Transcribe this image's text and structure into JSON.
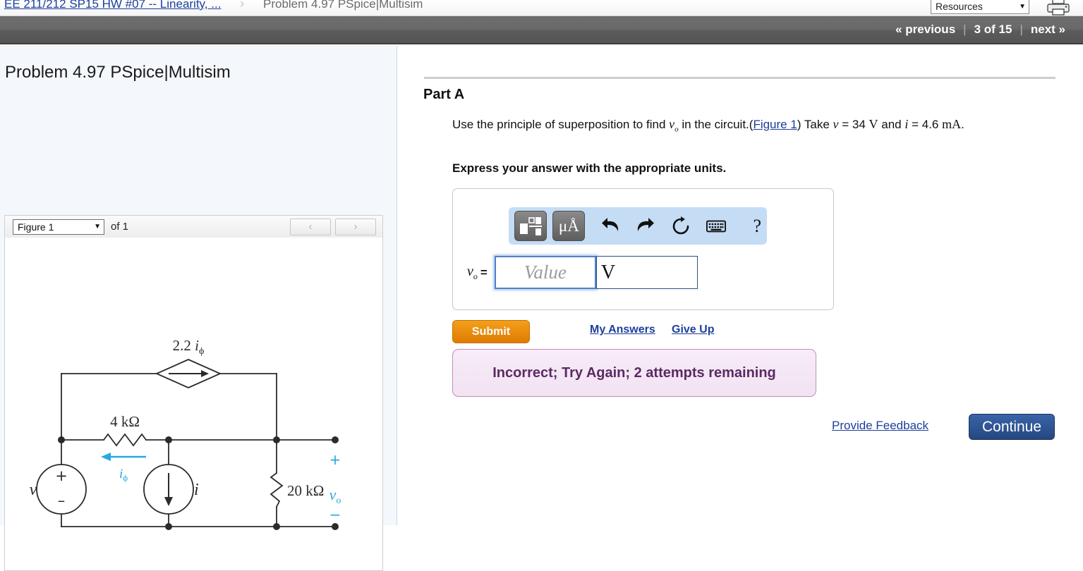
{
  "breadcrumb": {
    "parent_link": "EE 211/212 SP15 HW #07 -- Linearity, ...",
    "separator": "›",
    "current": "Problem 4.97 PSpice|Multisim"
  },
  "header": {
    "resources_label": "Resources",
    "resources_caret": "▼",
    "printer_icon": "printer-icon"
  },
  "nav": {
    "previous": "« previous",
    "pipe": "|",
    "page_indicator": "3 of 15",
    "next": "next »"
  },
  "left_panel": {
    "problem_title": "Problem 4.97 PSpice|Multisim",
    "figure_select_value": "Figure 1",
    "figure_select_caret": "▼",
    "figure_of": "of 1",
    "prev_arrow": "‹",
    "next_arrow": "›"
  },
  "figure": {
    "dependent_source_label": "2.2 i",
    "dependent_source_sub": "ϕ",
    "r1_label": "4 kΩ",
    "r2_label": "20 kΩ",
    "current_label_i": "i",
    "current_label_iphi": "i",
    "current_label_iphi_sub": "ϕ",
    "source_label_v": "v",
    "output_label": "v",
    "output_label_sub": "o",
    "plus_sign": "+",
    "minus_sign": "−",
    "accent_color": "#29a8df"
  },
  "part": {
    "label": "Part A",
    "question_pre": "Use the principle of superposition to find ",
    "question_vo": "v",
    "question_vo_sub": "o",
    "question_mid": " in the circuit.(",
    "figure_link": "Figure 1",
    "question_after_link": ") Take ",
    "var_v": "v",
    "eq1": " = 34 ",
    "unit_V": "V",
    "and_text": " and ",
    "var_i": "i",
    "eq2": " = 4.6 ",
    "unit_mA": "mA",
    "period": ".",
    "express_instruction": "Express your answer with the appropriate units."
  },
  "answer": {
    "toolbar": {
      "template_icon": "math-template-icon",
      "units_icon_label": "μÅ",
      "undo_icon": "undo-icon",
      "redo_icon": "redo-icon",
      "reset_icon": "reset-icon",
      "keyboard_icon": "keyboard-icon",
      "help_label": "?"
    },
    "variable": "v",
    "variable_sub": "o",
    "equals": "=",
    "value_placeholder": "Value",
    "units_value": "V"
  },
  "actions": {
    "submit_label": "Submit",
    "my_answers_label": "My Answers",
    "give_up_label": "Give Up",
    "provide_feedback_label": "Provide Feedback",
    "continue_label": "Continue"
  },
  "feedback": {
    "message": "Incorrect; Try Again; 2 attempts remaining"
  },
  "colors": {
    "submit_orange": "#e07b00",
    "continue_blue": "#25477f",
    "link_blue": "#1d3f9e",
    "feedback_purple": "#5a2a62",
    "toolbar_blue": "#c5dcf5"
  }
}
